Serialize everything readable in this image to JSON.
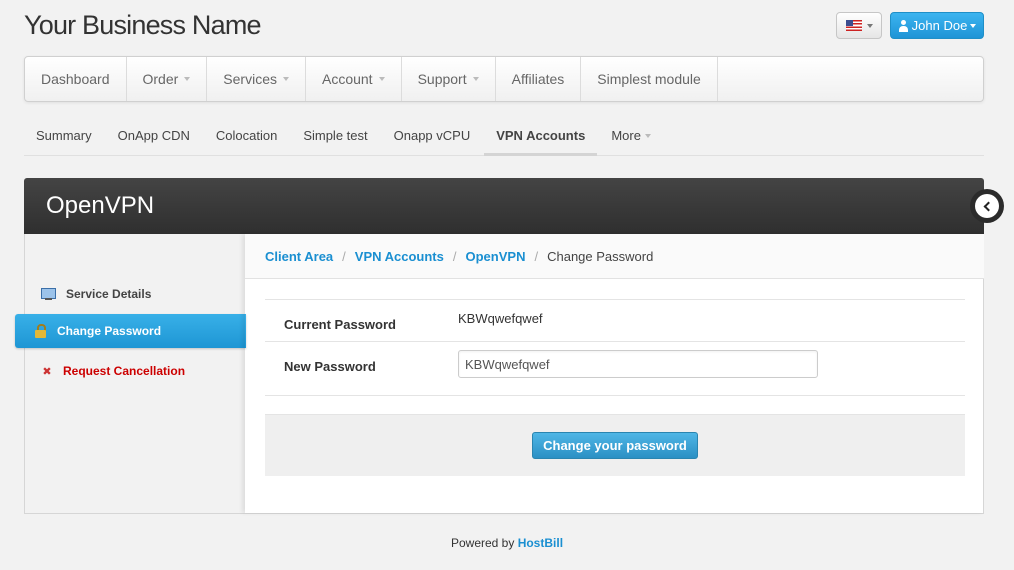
{
  "header": {
    "brand": "Your Business Name",
    "language_flag": "us-flag-icon",
    "user_name": "John Doe"
  },
  "nav": {
    "items": [
      {
        "label": "Dashboard",
        "dropdown": false
      },
      {
        "label": "Order",
        "dropdown": true
      },
      {
        "label": "Services",
        "dropdown": true
      },
      {
        "label": "Account",
        "dropdown": true
      },
      {
        "label": "Support",
        "dropdown": true
      },
      {
        "label": "Affiliates",
        "dropdown": false
      },
      {
        "label": "Simplest module",
        "dropdown": false
      }
    ]
  },
  "subnav": {
    "items": [
      {
        "label": "Summary"
      },
      {
        "label": "OnApp CDN"
      },
      {
        "label": "Colocation"
      },
      {
        "label": "Simple test"
      },
      {
        "label": "Onapp vCPU"
      },
      {
        "label": "VPN Accounts",
        "active": true
      },
      {
        "label": "More",
        "dropdown": true
      }
    ]
  },
  "page": {
    "title": "OpenVPN"
  },
  "sidebar": {
    "items": [
      {
        "label": "Service Details",
        "icon": "monitor-icon"
      },
      {
        "label": "Change Password",
        "icon": "lock-icon",
        "active": true
      },
      {
        "label": "Request Cancellation",
        "icon": "x-icon",
        "danger": true
      }
    ]
  },
  "breadcrumb": {
    "items": [
      "Client Area",
      "VPN Accounts",
      "OpenVPN"
    ],
    "current": "Change Password",
    "separator": "/"
  },
  "form": {
    "current_password_label": "Current Password",
    "current_password_value": "KBWqwefqwef",
    "new_password_label": "New Password",
    "new_password_value": "KBWqwefqwef",
    "submit_label": "Change your password"
  },
  "footer": {
    "prefix": "Powered by",
    "link": "HostBill"
  },
  "colors": {
    "accent": "#1a8fd1",
    "header_bar": "#333333",
    "danger": "#cc0000"
  }
}
